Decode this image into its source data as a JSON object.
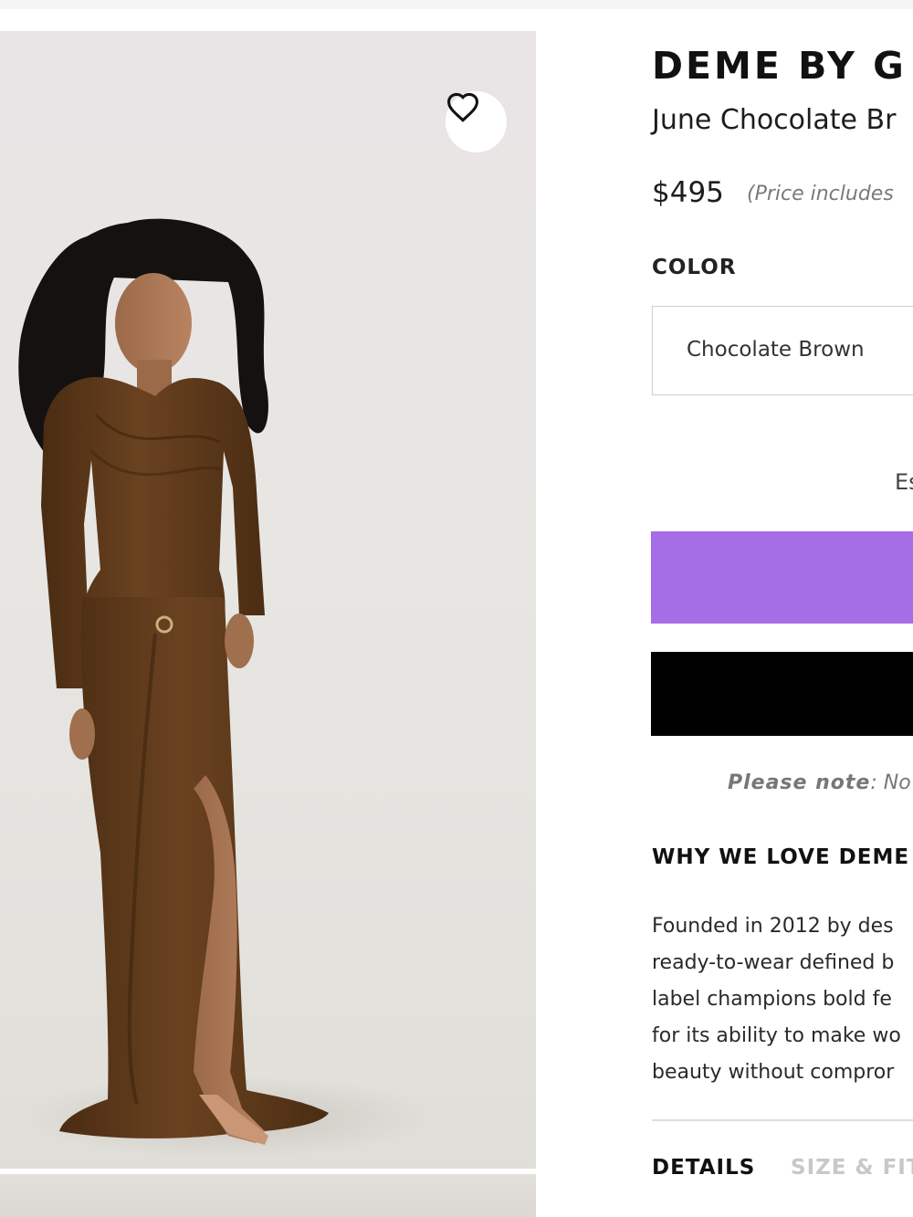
{
  "product": {
    "brand": "DEME BY G",
    "name": "June Chocolate Br",
    "price": "$495",
    "price_note": "(Price includes"
  },
  "color": {
    "label": "COLOR",
    "selected": "Chocolate Brown"
  },
  "delivery": {
    "estimate_text": "Es"
  },
  "notice": {
    "label": "Please note",
    "text": ": No"
  },
  "about": {
    "heading": "WHY WE LOVE DEME",
    "lines": [
      "Founded in 2012 by des",
      "ready-to-wear defined b",
      "label champions bold fe",
      "for its ability to make wo",
      "beauty without compror"
    ]
  },
  "tabs": [
    {
      "label": "DETAILS",
      "active": true
    },
    {
      "label": "SIZE & FIT",
      "active": false
    }
  ],
  "colors": {
    "primary_button": "#a56ee6",
    "secondary_button": "#000000",
    "dress": "#5a3718"
  },
  "icons": {
    "favorite": "heart-outline-icon"
  }
}
